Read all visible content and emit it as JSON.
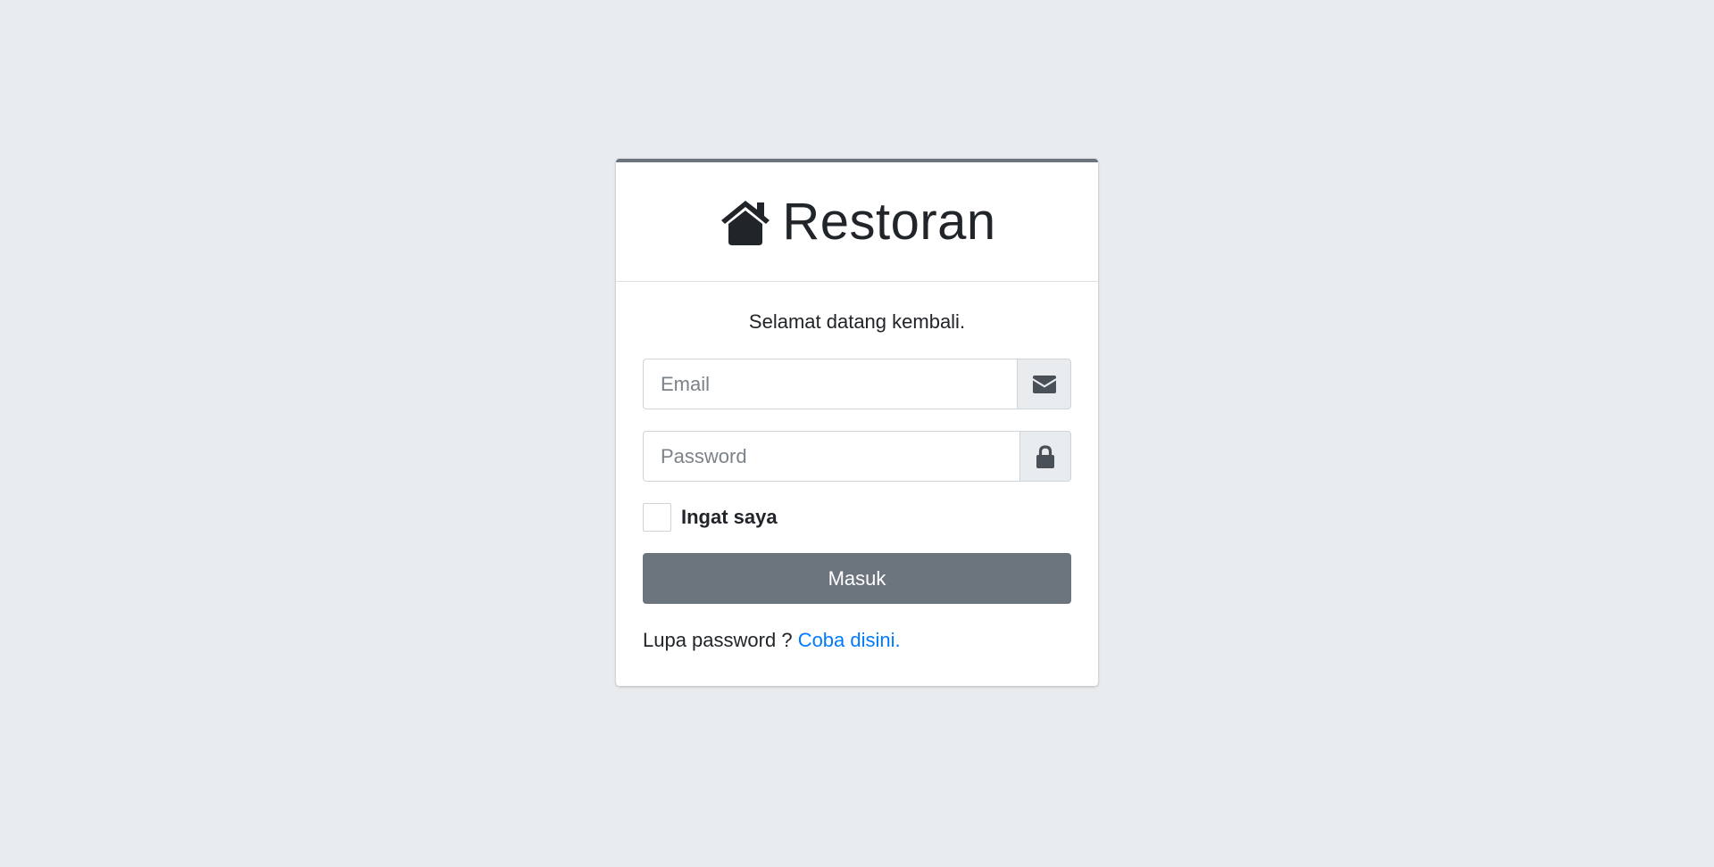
{
  "brand": {
    "icon": "home-icon",
    "title": "Restoran"
  },
  "login": {
    "welcome": "Selamat datang kembali.",
    "email": {
      "placeholder": "Email",
      "value": "",
      "icon": "envelope-icon"
    },
    "password": {
      "placeholder": "Password",
      "value": "",
      "icon": "lock-icon"
    },
    "remember_label": "Ingat saya",
    "remember_checked": false,
    "submit_label": "Masuk",
    "forgot_text": "Lupa password ?",
    "forgot_link": "Coba disini."
  },
  "colors": {
    "background": "#e9ecef",
    "card_top_border": "#6c757d",
    "button": "#6c757d",
    "link": "#007bff"
  }
}
